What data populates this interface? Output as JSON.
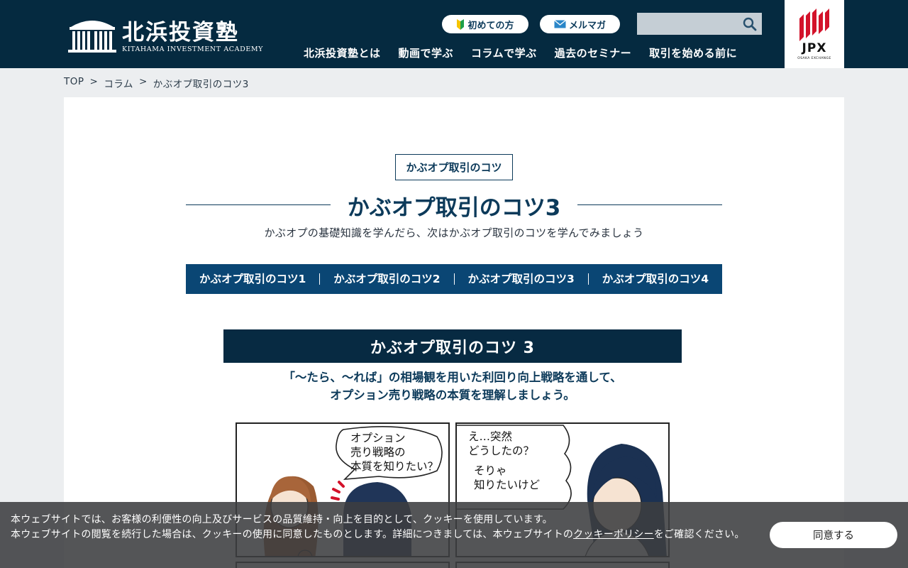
{
  "header": {
    "logo_title": "北浜投資塾",
    "logo_subtitle": "KITAHAMA INVESTMENT ACADEMY",
    "beginner_label": "初めての方",
    "magazine_label": "メルマガ",
    "search": {
      "value": "",
      "placeholder": ""
    },
    "nav": [
      "北浜投資塾とは",
      "動画で学ぶ",
      "コラムで学ぶ",
      "過去のセミナー",
      "取引を始める前に"
    ],
    "jpx": {
      "name": "JPX",
      "sub": "OSAKA EXCHANGE"
    }
  },
  "breadcrumb": [
    "TOP",
    ">",
    "コラム",
    ">",
    "かぶオプ取引のコツ3"
  ],
  "article": {
    "tag": "かぶオプ取引のコツ",
    "title": "かぶオプ取引のコツ3",
    "lead": "かぶオプの基礎知識を学んだら、次はかぶオプ取引のコツを学んでみましょう",
    "tabs": [
      "かぶオプ取引のコツ1",
      "かぶオプ取引のコツ2",
      "かぶオプ取引のコツ3",
      "かぶオプ取引のコツ4"
    ]
  },
  "manga": {
    "banner": "かぶオプ取引のコツ 3",
    "caption_line1": "「〜たら、〜れば」の相場観を用いた利回り向上戦略を通して、",
    "caption_line2": "オプション売り戦略の本質を理解しましょう。",
    "bubble1": [
      "オプション",
      "売り戦略の",
      "本質を知りたい？"
    ],
    "bubble2": [
      "え…突然",
      "どうしたの？"
    ],
    "bubble3": [
      "そりゃ",
      "知りたいけど"
    ]
  },
  "cookie": {
    "line1": "本ウェブサイトでは、お客様の利便性の向上及びサービスの品質維持・向上を目的として、クッキーを使用しています。",
    "line2_pre": "本ウェブサイトの閲覧を続行した場合は、クッキーの使用に同意したものとします。詳細につきましては、本ウェブサイトの",
    "policy_link": "クッキーポリシー",
    "line2_post": "をご確認ください。",
    "agree_button": "同意する"
  },
  "colors": {
    "header_bg": "#052a40",
    "accent": "#0a4674",
    "jpx_red": "#d3122a"
  }
}
